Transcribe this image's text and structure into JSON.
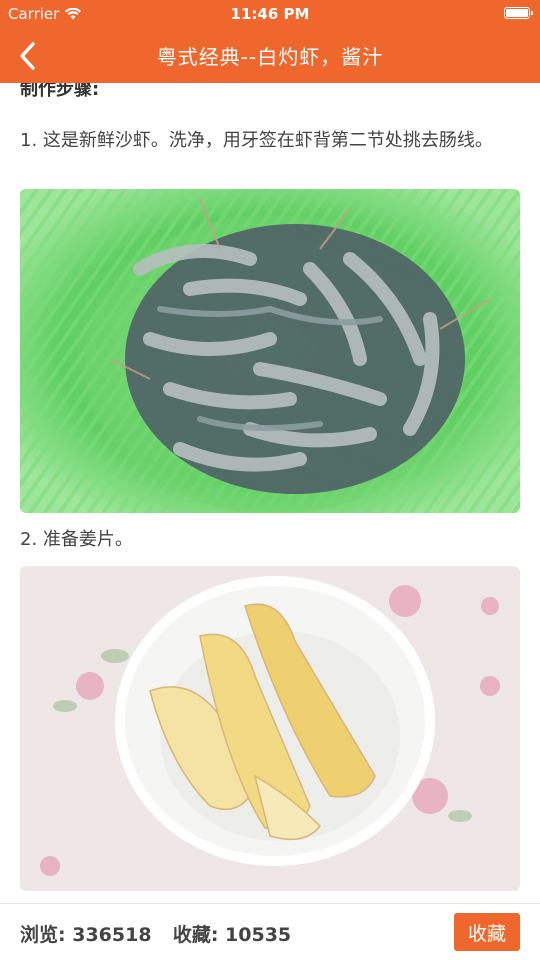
{
  "status_bar": {
    "carrier": "Carrier",
    "time": "11:46 PM",
    "wifi_icon": "wifi-icon",
    "battery_icon": "battery-icon"
  },
  "nav": {
    "title": "粤式经典--白灼虾，酱汁",
    "back_icon": "chevron-left-icon"
  },
  "content": {
    "section_heading": "制作步骤:",
    "steps": [
      {
        "text": "1. 这是新鲜沙虾。洗净，用牙签在虾背第二节处挑去肠线。",
        "image": "shrimp-in-green-basket"
      },
      {
        "text": "2. 准备姜片。",
        "image": "ginger-slices-in-bowl"
      }
    ]
  },
  "bottom_bar": {
    "views_label": "浏览:",
    "views_value": "336518",
    "favorites_label": "收藏:",
    "favorites_value": "10535",
    "favorite_button": "收藏"
  },
  "colors": {
    "accent": "#f0672e",
    "text": "#444444",
    "background": "#ffffff"
  }
}
